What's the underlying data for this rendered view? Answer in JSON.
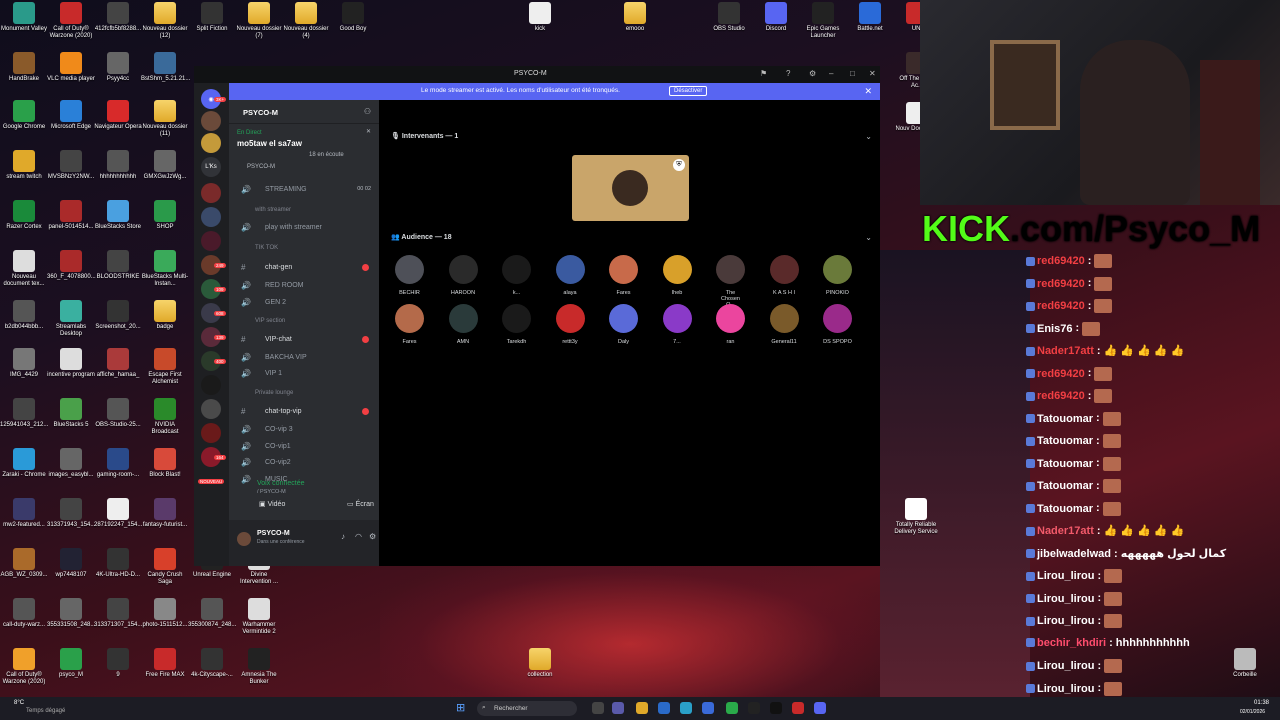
{
  "desktop_icons": [
    {
      "label": "Monument Valley"
    },
    {
      "label": "Call of Duty® Warzone (2020)"
    },
    {
      "label": "412fcfb5bf8288..."
    },
    {
      "label": "Nouveau dossier (12)"
    },
    {
      "label": "Split Fiction"
    },
    {
      "label": "Nouveau dossier (7)"
    },
    {
      "label": "Nouveau dossier (4)"
    },
    {
      "label": "Good Boy"
    },
    {
      "label": "kick"
    },
    {
      "label": "emooo"
    },
    {
      "label": "OBS Studio"
    },
    {
      "label": "Discord"
    },
    {
      "label": "Epic Games Launcher"
    },
    {
      "label": "Battle.net"
    },
    {
      "label": "UNI"
    },
    {
      "label": "HandBrake"
    },
    {
      "label": "VLC media player"
    },
    {
      "label": "Psyy4cc"
    },
    {
      "label": "BstShm_5.21.21..."
    },
    {
      "label": "Google Chrome"
    },
    {
      "label": "Microsoft Edge"
    },
    {
      "label": "Navigateur Opera"
    },
    {
      "label": "Nouveau dossier (11)"
    },
    {
      "label": "stream twitch"
    },
    {
      "label": "MVSBNzY2NW..."
    },
    {
      "label": "hhhhhhhhhhh"
    },
    {
      "label": "GMXGwJzWg..."
    },
    {
      "label": "Razer Cortex"
    },
    {
      "label": "panel-5014514..."
    },
    {
      "label": "BlueStacks Store"
    },
    {
      "label": "SHOP"
    },
    {
      "label": "Nouveau document tex..."
    },
    {
      "label": "360_F_4078800..."
    },
    {
      "label": "BLOODSTRIKE"
    },
    {
      "label": "BlueStacks Multi-Instan..."
    },
    {
      "label": "b2db044bbb..."
    },
    {
      "label": "Streamlabs Desktop"
    },
    {
      "label": "Screenshot_20..."
    },
    {
      "label": "badge"
    },
    {
      "label": "IMG_4429"
    },
    {
      "label": "incentive program"
    },
    {
      "label": "affiche_hamaa_"
    },
    {
      "label": "Escape First Alchemist"
    },
    {
      "label": "125941043_212..."
    },
    {
      "label": "BlueStacks 5"
    },
    {
      "label": "OBS-Studio-25..."
    },
    {
      "label": "NVIDIA Broadcast"
    },
    {
      "label": "Zaraki - Chrome"
    },
    {
      "label": "images_easybl..."
    },
    {
      "label": "gaming-room-..."
    },
    {
      "label": "Block Blast!"
    },
    {
      "label": "mw2-featured..."
    },
    {
      "label": "313371943_154..."
    },
    {
      "label": "287192247_154..."
    },
    {
      "label": "fantasy-futurist..."
    },
    {
      "label": "AGB_WZ_0309..."
    },
    {
      "label": "wp7448107"
    },
    {
      "label": "4K-Ultra-HD-D..."
    },
    {
      "label": "Candy Crush Saga"
    },
    {
      "label": "Unreal Engine"
    },
    {
      "label": "Divine Intervention ..."
    },
    {
      "label": "call-duty-warz..."
    },
    {
      "label": "355331508_248..."
    },
    {
      "label": "313371307_154..."
    },
    {
      "label": "photo-1511512..."
    },
    {
      "label": "355300874_248..."
    },
    {
      "label": "Warhammer Vermintide 2"
    },
    {
      "label": "Call of Duty® Warzone (2020)"
    },
    {
      "label": "psyco_M"
    },
    {
      "label": "9"
    },
    {
      "label": "Free Fire MAX"
    },
    {
      "label": "4k-Cityscape-..."
    },
    {
      "label": "Amnesia The Bunker"
    },
    {
      "label": "Off The Early Ac..."
    },
    {
      "label": "Nouv Docume..."
    },
    {
      "label": "Totally Reliable Delivery Service"
    },
    {
      "label": "collection"
    },
    {
      "label": "Corbeille"
    }
  ],
  "discord": {
    "title": "PSYCO-M",
    "banner": {
      "message": "Le mode streamer est activé. Les noms d'utilisateur ont été tronqués.",
      "button": "Désactiver"
    },
    "guild_badges": [
      "3K+",
      "249",
      "109",
      "608",
      "139",
      "400",
      "164",
      "NOUVEAU"
    ],
    "guild_label": "L'Ks",
    "server_name": "PSYCO-M",
    "live": {
      "status": "En Direct",
      "title": "mo5taw el sa7aw",
      "listeners": "18 en écoute",
      "server": "PSYCO-M"
    },
    "channels": [
      {
        "label": "STREAMING",
        "counts": "00 02"
      },
      {
        "label": "with streamer"
      },
      {
        "label": "play with streamer"
      },
      {
        "label": "TIK TOK"
      },
      {
        "label": "chat-gen"
      },
      {
        "label": "RED ROOM"
      },
      {
        "label": "GEN 2"
      },
      {
        "label": "VIP section"
      },
      {
        "label": "VIP-chat"
      },
      {
        "label": "BAKCHA VIP"
      },
      {
        "label": "VIP 1"
      },
      {
        "label": "Private lounge"
      },
      {
        "label": "chat-top-vip"
      },
      {
        "label": "CO-vip 3"
      },
      {
        "label": "CO-vip1"
      },
      {
        "label": "CO-vip2"
      },
      {
        "label": "MUSIC"
      }
    ],
    "voice": {
      "status": "Voix connectée",
      "sub": "/ PSYCO-M",
      "video": "Vidéo",
      "screen": "Écran"
    },
    "user": {
      "name": "PSYCO-M",
      "status": "Dans une conférence"
    },
    "speakers_header": "Intervenants — 1",
    "audience_header": "Audience — 18",
    "audience": [
      "BECHIR",
      "HAROON",
      "k...",
      "alaya",
      "Fares",
      "Iheb",
      "The Chosen O...",
      "K A S H I",
      "PINOKIO",
      "Fares",
      "AMN",
      "Tarekdh",
      "rettt3y",
      "Daly",
      "7...",
      "ran",
      "General11",
      "DS SPOPO"
    ]
  },
  "overlay": {
    "kick_prefix": "KICK",
    "kick_rest": ".com/Psyco_M",
    "chat": [
      {
        "user": "red69420",
        "text": ":",
        "color": "#f23f43"
      },
      {
        "user": "red69420",
        "text": ":",
        "color": "#f23f43"
      },
      {
        "user": "red69420",
        "text": ":",
        "color": "#f23f43"
      },
      {
        "user": "Enis76",
        "text": ":",
        "color": "#ffffff"
      },
      {
        "user": "Nader17att",
        "text": ": 👍 👍 👍 👍 👍",
        "color": "#f23f43"
      },
      {
        "user": "red69420",
        "text": ":",
        "color": "#f23f43"
      },
      {
        "user": "red69420",
        "text": ":",
        "color": "#f23f43"
      },
      {
        "user": "Tatouomar",
        "text": ":",
        "color": "#ffffff"
      },
      {
        "user": "Tatouomar",
        "text": ":",
        "color": "#ffffff"
      },
      {
        "user": "Tatouomar",
        "text": ":",
        "color": "#ffffff"
      },
      {
        "user": "Tatouomar",
        "text": ":",
        "color": "#ffffff"
      },
      {
        "user": "Tatouomar",
        "text": ":",
        "color": "#ffffff"
      },
      {
        "user": "Nader17att",
        "text": ": 👍 👍 👍 👍 👍",
        "color": "#f25a6a"
      },
      {
        "user": "jibelwadelwad",
        "text": ": كمال لحول هههههه",
        "color": "#ffffff"
      },
      {
        "user": "Lirou_lirou",
        "text": ":",
        "color": "#ffffff"
      },
      {
        "user": "Lirou_lirou",
        "text": ":",
        "color": "#ffffff"
      },
      {
        "user": "Lirou_lirou",
        "text": ":",
        "color": "#ffffff"
      },
      {
        "user": "bechir_khdiri",
        "text": ": hhhhhhhhhhh",
        "color": "#ff4d6d"
      },
      {
        "user": "Lirou_lirou",
        "text": ":",
        "color": "#ffffff"
      },
      {
        "user": "Lirou_lirou",
        "text": ":",
        "color": "#ffffff"
      }
    ]
  },
  "taskbar": {
    "weather": "8°C",
    "weather_sub": "Temps dégagé",
    "search": "Rechercher",
    "time": "01:38",
    "date": "02/01/2026"
  }
}
